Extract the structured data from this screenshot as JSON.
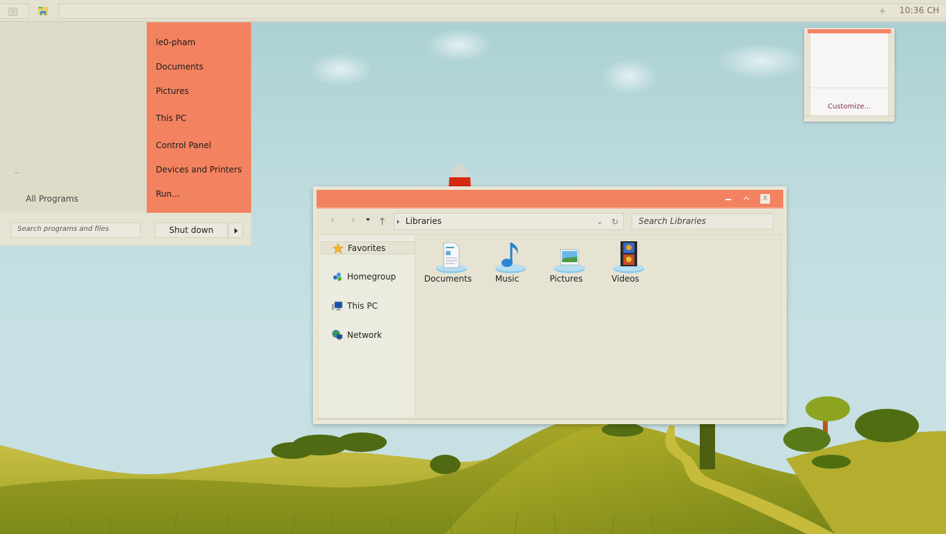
{
  "taskbar": {
    "clock": "10:36 CH",
    "tray_icon": "plus-icon",
    "pinned": [
      {
        "name": "file-explorer",
        "icon": "folder-icon"
      }
    ]
  },
  "start_menu": {
    "all_programs": "All Programs",
    "right_items": [
      {
        "label": "le0-pham"
      },
      {
        "label": "Documents"
      },
      {
        "label": "Pictures"
      },
      {
        "label": "This PC"
      },
      {
        "label": "Control Panel"
      },
      {
        "label": "Devices and Printers"
      },
      {
        "label": "Run..."
      }
    ],
    "search_placeholder": "Search programs and files",
    "shutdown_label": "Shut down"
  },
  "tray_popup": {
    "customize_label": "Customize..."
  },
  "explorer": {
    "address": "Libraries",
    "search_placeholder": "Search Libraries",
    "nav_pane": [
      {
        "label": "Favorites",
        "icon": "star-icon",
        "selected": true
      },
      {
        "label": "Homegroup",
        "icon": "homegroup-icon"
      },
      {
        "label": "This PC",
        "icon": "computer-icon"
      },
      {
        "label": "Network",
        "icon": "network-icon"
      }
    ],
    "libraries": [
      {
        "label": "Documents",
        "icon": "documents-library-icon"
      },
      {
        "label": "Music",
        "icon": "music-library-icon"
      },
      {
        "label": "Pictures",
        "icon": "pictures-library-icon"
      },
      {
        "label": "Videos",
        "icon": "videos-library-icon"
      }
    ]
  },
  "colors": {
    "accent": "#f38260",
    "panel": "#e6e3d3",
    "customize_text": "#7b2e4a"
  }
}
